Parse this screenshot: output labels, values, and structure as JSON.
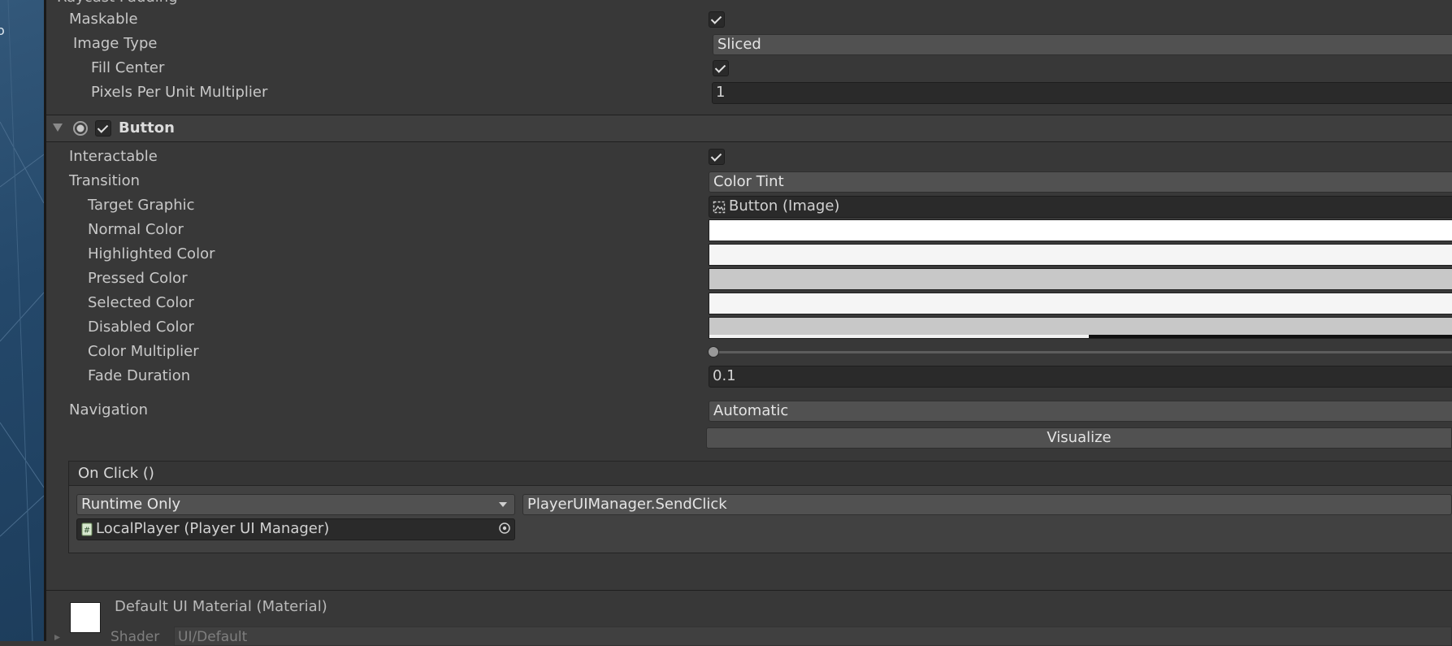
{
  "image_section": {
    "truncated_label": "Raycast Padding",
    "maskable_label": "Maskable",
    "maskable_checked": true,
    "image_type_label": "Image Type",
    "image_type_value": "Sliced",
    "fill_center_label": "Fill Center",
    "fill_center_checked": true,
    "pixels_per_unit_label": "Pixels Per Unit Multiplier",
    "pixels_per_unit_value": "1"
  },
  "button_component": {
    "title": "Button",
    "enabled": true,
    "interactable_label": "Interactable",
    "interactable_checked": true,
    "transition_label": "Transition",
    "transition_value": "Color Tint",
    "target_graphic_label": "Target Graphic",
    "target_graphic_value": "Button (Image)",
    "normal_color_label": "Normal Color",
    "highlighted_color_label": "Highlighted Color",
    "pressed_color_label": "Pressed Color",
    "selected_color_label": "Selected Color",
    "disabled_color_label": "Disabled Color",
    "color_multiplier_label": "Color Multiplier",
    "color_multiplier_value": 0,
    "fade_duration_label": "Fade Duration",
    "fade_duration_value": "0.1",
    "navigation_label": "Navigation",
    "navigation_value": "Automatic",
    "visualize_label": "Visualize",
    "colors": {
      "normal": "#ffffff",
      "highlighted": "#f5f5f5",
      "pressed": "#c8c8c8",
      "selected": "#f5f5f5",
      "disabled": "#c8c8c8",
      "disabled_alpha": 0.5
    }
  },
  "on_click_event": {
    "title": "On Click ()",
    "runtime_value": "Runtime Only",
    "function_value": "PlayerUIManager.SendClick",
    "target_object_value": "LocalPlayer (Player UI Manager)"
  },
  "material_section": {
    "title": "Default UI Material (Material)",
    "shader_label": "Shader",
    "shader_value": "UI/Default"
  },
  "icons": [
    "foldout-arrow-icon",
    "toggle-circle-icon",
    "checkmark-icon",
    "image-object-icon",
    "script-icon",
    "object-picker-icon",
    "dropdown-arrow-icon"
  ]
}
